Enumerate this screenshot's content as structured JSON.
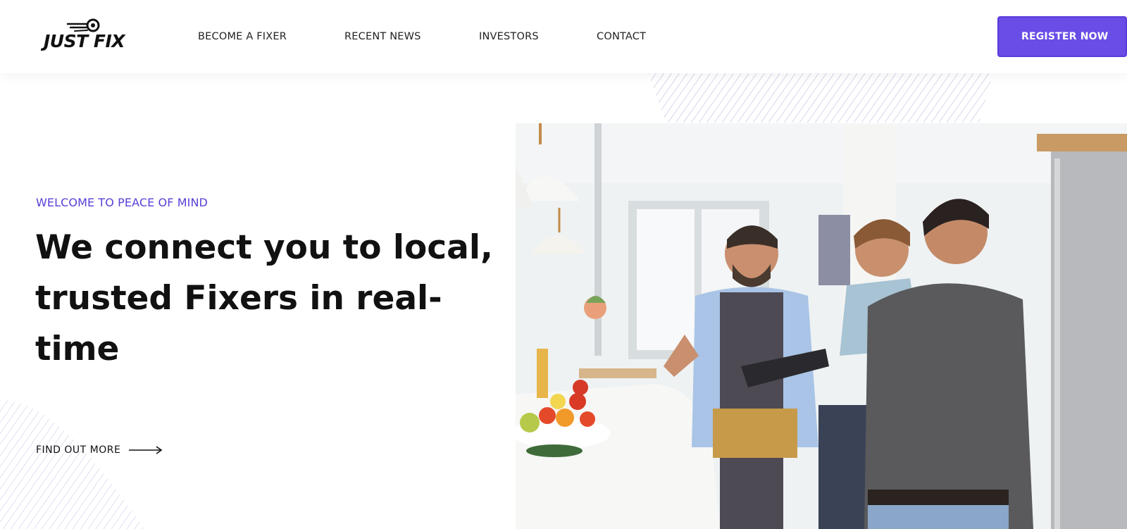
{
  "brand": {
    "name": "JUST FIX"
  },
  "nav": {
    "items": [
      {
        "label": "BECOME A FIXER"
      },
      {
        "label": "RECENT NEWS"
      },
      {
        "label": "INVESTORS"
      },
      {
        "label": "CONTACT"
      }
    ],
    "cta_label": "REGISTER NOW"
  },
  "hero": {
    "eyebrow": "WELCOME TO PEACE OF MIND",
    "headline_lines": [
      "We connect you to local,",
      "trusted Fixers in real-",
      "time"
    ],
    "cta_label": "FIND OUT MORE",
    "cta_icon": "arrow-right-icon"
  },
  "colors": {
    "accent": "#6a4ce6",
    "eyebrow": "#5b3fd6",
    "text": "#111111"
  }
}
